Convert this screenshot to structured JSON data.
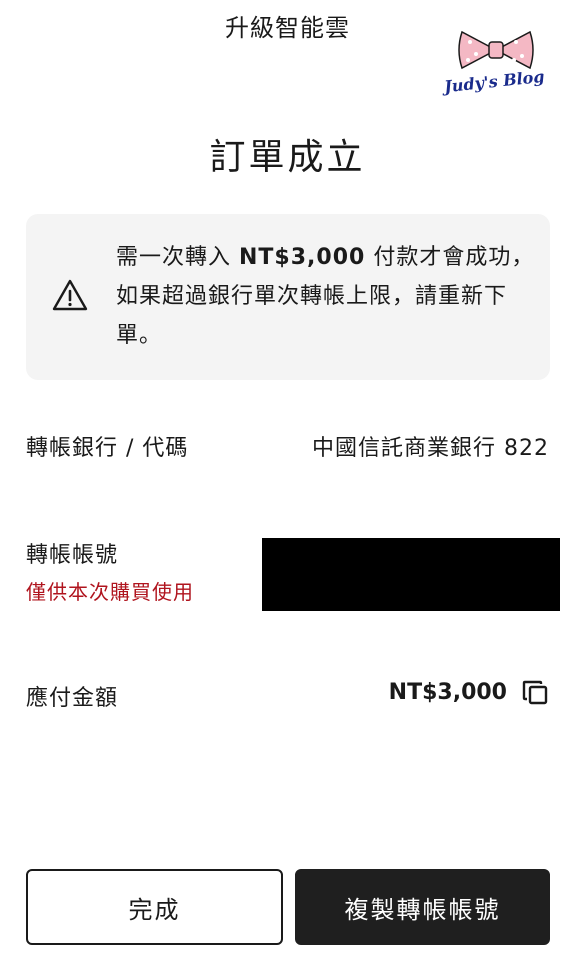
{
  "header": {
    "title": "升級智能雲"
  },
  "watermark": {
    "text": "Judy's Blog",
    "bow_color": "#f4b8c4"
  },
  "page_title": "訂單成立",
  "notice": {
    "icon": "warning-icon",
    "text_before": "需一次轉入 ",
    "amount": "NT$3,000",
    "text_after": " 付款才會成功，如果超過銀行單次轉帳上限，請重新下單。"
  },
  "bank": {
    "label": "轉帳銀行 / 代碼",
    "value": "中國信託商業銀行 822"
  },
  "account": {
    "label": "轉帳帳號",
    "note": "僅供本次購買使用",
    "note_color": "#b0141e"
  },
  "amount": {
    "label": "應付金額",
    "value": "NT$3,000",
    "copy_icon": "copy-icon"
  },
  "buttons": {
    "done_label": "完成",
    "copy_label": "複製轉帳帳號"
  }
}
